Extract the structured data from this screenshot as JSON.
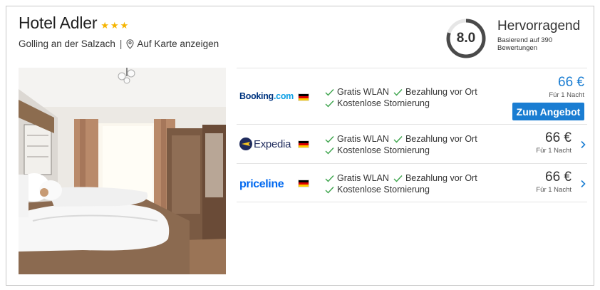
{
  "hotel": {
    "name": "Hotel Adler",
    "stars": 3,
    "star_glyph": "★",
    "location": "Golling an der Salzach",
    "separator": "|",
    "map_link": "Auf Karte anzeigen"
  },
  "rating": {
    "score": "8.0",
    "score_fraction": 0.8,
    "label": "Hervorragend",
    "subtext": "Basierend auf 390 Bewertungen"
  },
  "photo": {
    "icon": "hotel-room-photo"
  },
  "offers": [
    {
      "provider": "Booking.com",
      "country_flag": "germany-flag-icon",
      "features_line1": [
        "Gratis WLAN",
        "Bezahlung vor Ort"
      ],
      "features_line2": [
        "Kostenlose Stornierung"
      ],
      "price": "66 €",
      "per_night": "Für 1 Nacht",
      "cta": "Zum Angebot",
      "highlight": true
    },
    {
      "provider": "Expedia",
      "country_flag": "germany-flag-icon",
      "features_line1": [
        "Gratis WLAN",
        "Bezahlung vor Ort"
      ],
      "features_line2": [
        "Kostenlose Stornierung"
      ],
      "price": "66 €",
      "per_night": "Für 1 Nacht",
      "highlight": false
    },
    {
      "provider": "priceline",
      "country_flag": "germany-flag-icon",
      "features_line1": [
        "Gratis WLAN",
        "Bezahlung vor Ort"
      ],
      "features_line2": [
        "Kostenlose Stornierung"
      ],
      "price": "66 €",
      "per_night": "Für 1 Nacht",
      "highlight": false
    }
  ],
  "colors": {
    "accent": "#1a7dd2",
    "star": "#f5b400",
    "check": "#3aa34a",
    "booking_blue": "#003580",
    "booking_light": "#0c9fe5",
    "expedia_navy": "#1f2b5c",
    "expedia_yellow": "#fbc81f",
    "priceline_blue": "#0068ef"
  }
}
